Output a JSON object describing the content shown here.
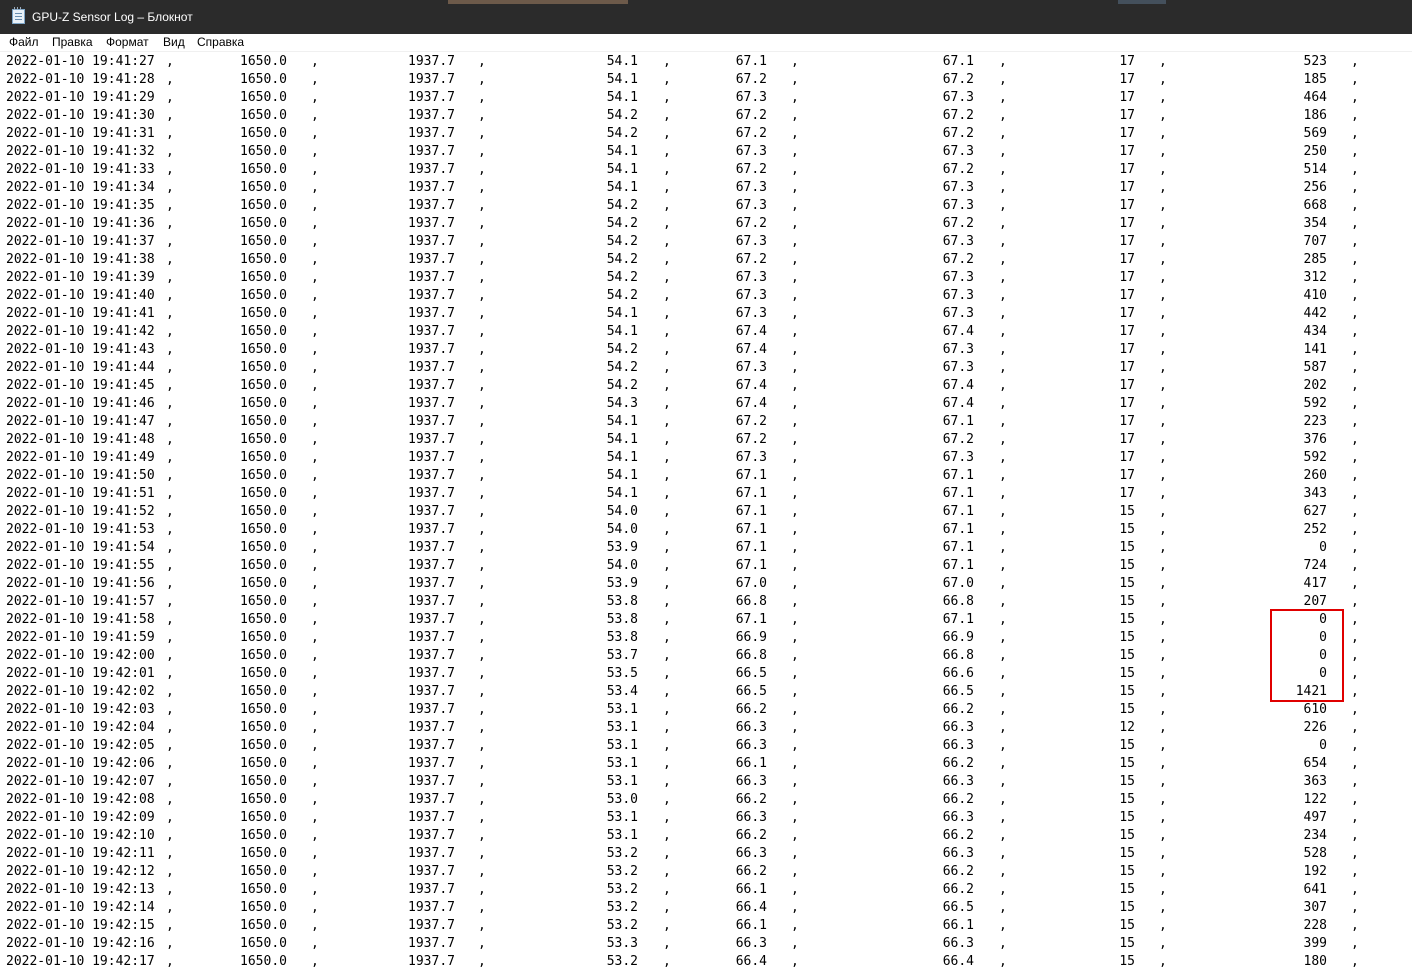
{
  "window": {
    "title": "GPU-Z Sensor Log – Блокнот",
    "app_icon": "notepad-icon"
  },
  "menu": [
    "Файл",
    "Правка",
    "Формат",
    "Вид",
    "Справка"
  ],
  "log": {
    "separator": ",",
    "rows": [
      [
        "2022-01-10 19:41:27",
        "1650.0",
        "1937.7",
        "54.1",
        "67.1",
        "67.1",
        "17",
        "523"
      ],
      [
        "2022-01-10 19:41:28",
        "1650.0",
        "1937.7",
        "54.1",
        "67.2",
        "67.2",
        "17",
        "185"
      ],
      [
        "2022-01-10 19:41:29",
        "1650.0",
        "1937.7",
        "54.1",
        "67.3",
        "67.3",
        "17",
        "464"
      ],
      [
        "2022-01-10 19:41:30",
        "1650.0",
        "1937.7",
        "54.2",
        "67.2",
        "67.2",
        "17",
        "186"
      ],
      [
        "2022-01-10 19:41:31",
        "1650.0",
        "1937.7",
        "54.2",
        "67.2",
        "67.2",
        "17",
        "569"
      ],
      [
        "2022-01-10 19:41:32",
        "1650.0",
        "1937.7",
        "54.1",
        "67.3",
        "67.3",
        "17",
        "250"
      ],
      [
        "2022-01-10 19:41:33",
        "1650.0",
        "1937.7",
        "54.1",
        "67.2",
        "67.2",
        "17",
        "514"
      ],
      [
        "2022-01-10 19:41:34",
        "1650.0",
        "1937.7",
        "54.1",
        "67.3",
        "67.3",
        "17",
        "256"
      ],
      [
        "2022-01-10 19:41:35",
        "1650.0",
        "1937.7",
        "54.2",
        "67.3",
        "67.3",
        "17",
        "668"
      ],
      [
        "2022-01-10 19:41:36",
        "1650.0",
        "1937.7",
        "54.2",
        "67.2",
        "67.2",
        "17",
        "354"
      ],
      [
        "2022-01-10 19:41:37",
        "1650.0",
        "1937.7",
        "54.2",
        "67.3",
        "67.3",
        "17",
        "707"
      ],
      [
        "2022-01-10 19:41:38",
        "1650.0",
        "1937.7",
        "54.2",
        "67.2",
        "67.2",
        "17",
        "285"
      ],
      [
        "2022-01-10 19:41:39",
        "1650.0",
        "1937.7",
        "54.2",
        "67.3",
        "67.3",
        "17",
        "312"
      ],
      [
        "2022-01-10 19:41:40",
        "1650.0",
        "1937.7",
        "54.2",
        "67.3",
        "67.3",
        "17",
        "410"
      ],
      [
        "2022-01-10 19:41:41",
        "1650.0",
        "1937.7",
        "54.1",
        "67.3",
        "67.3",
        "17",
        "442"
      ],
      [
        "2022-01-10 19:41:42",
        "1650.0",
        "1937.7",
        "54.1",
        "67.4",
        "67.4",
        "17",
        "434"
      ],
      [
        "2022-01-10 19:41:43",
        "1650.0",
        "1937.7",
        "54.2",
        "67.4",
        "67.3",
        "17",
        "141"
      ],
      [
        "2022-01-10 19:41:44",
        "1650.0",
        "1937.7",
        "54.2",
        "67.3",
        "67.3",
        "17",
        "587"
      ],
      [
        "2022-01-10 19:41:45",
        "1650.0",
        "1937.7",
        "54.2",
        "67.4",
        "67.4",
        "17",
        "202"
      ],
      [
        "2022-01-10 19:41:46",
        "1650.0",
        "1937.7",
        "54.3",
        "67.4",
        "67.4",
        "17",
        "592"
      ],
      [
        "2022-01-10 19:41:47",
        "1650.0",
        "1937.7",
        "54.1",
        "67.2",
        "67.1",
        "17",
        "223"
      ],
      [
        "2022-01-10 19:41:48",
        "1650.0",
        "1937.7",
        "54.1",
        "67.2",
        "67.2",
        "17",
        "376"
      ],
      [
        "2022-01-10 19:41:49",
        "1650.0",
        "1937.7",
        "54.1",
        "67.3",
        "67.3",
        "17",
        "592"
      ],
      [
        "2022-01-10 19:41:50",
        "1650.0",
        "1937.7",
        "54.1",
        "67.1",
        "67.1",
        "17",
        "260"
      ],
      [
        "2022-01-10 19:41:51",
        "1650.0",
        "1937.7",
        "54.1",
        "67.1",
        "67.1",
        "17",
        "343"
      ],
      [
        "2022-01-10 19:41:52",
        "1650.0",
        "1937.7",
        "54.0",
        "67.1",
        "67.1",
        "15",
        "627"
      ],
      [
        "2022-01-10 19:41:53",
        "1650.0",
        "1937.7",
        "54.0",
        "67.1",
        "67.1",
        "15",
        "252"
      ],
      [
        "2022-01-10 19:41:54",
        "1650.0",
        "1937.7",
        "53.9",
        "67.1",
        "67.1",
        "15",
        "0"
      ],
      [
        "2022-01-10 19:41:55",
        "1650.0",
        "1937.7",
        "54.0",
        "67.1",
        "67.1",
        "15",
        "724"
      ],
      [
        "2022-01-10 19:41:56",
        "1650.0",
        "1937.7",
        "53.9",
        "67.0",
        "67.0",
        "15",
        "417"
      ],
      [
        "2022-01-10 19:41:57",
        "1650.0",
        "1937.7",
        "53.8",
        "66.8",
        "66.8",
        "15",
        "207"
      ],
      [
        "2022-01-10 19:41:58",
        "1650.0",
        "1937.7",
        "53.8",
        "67.1",
        "67.1",
        "15",
        "0"
      ],
      [
        "2022-01-10 19:41:59",
        "1650.0",
        "1937.7",
        "53.8",
        "66.9",
        "66.9",
        "15",
        "0"
      ],
      [
        "2022-01-10 19:42:00",
        "1650.0",
        "1937.7",
        "53.7",
        "66.8",
        "66.8",
        "15",
        "0"
      ],
      [
        "2022-01-10 19:42:01",
        "1650.0",
        "1937.7",
        "53.5",
        "66.5",
        "66.6",
        "15",
        "0"
      ],
      [
        "2022-01-10 19:42:02",
        "1650.0",
        "1937.7",
        "53.4",
        "66.5",
        "66.5",
        "15",
        "1421"
      ],
      [
        "2022-01-10 19:42:03",
        "1650.0",
        "1937.7",
        "53.1",
        "66.2",
        "66.2",
        "15",
        "610"
      ],
      [
        "2022-01-10 19:42:04",
        "1650.0",
        "1937.7",
        "53.1",
        "66.3",
        "66.3",
        "12",
        "226"
      ],
      [
        "2022-01-10 19:42:05",
        "1650.0",
        "1937.7",
        "53.1",
        "66.3",
        "66.3",
        "15",
        "0"
      ],
      [
        "2022-01-10 19:42:06",
        "1650.0",
        "1937.7",
        "53.1",
        "66.1",
        "66.2",
        "15",
        "654"
      ],
      [
        "2022-01-10 19:42:07",
        "1650.0",
        "1937.7",
        "53.1",
        "66.3",
        "66.3",
        "15",
        "363"
      ],
      [
        "2022-01-10 19:42:08",
        "1650.0",
        "1937.7",
        "53.0",
        "66.2",
        "66.2",
        "15",
        "122"
      ],
      [
        "2022-01-10 19:42:09",
        "1650.0",
        "1937.7",
        "53.1",
        "66.3",
        "66.3",
        "15",
        "497"
      ],
      [
        "2022-01-10 19:42:10",
        "1650.0",
        "1937.7",
        "53.1",
        "66.2",
        "66.2",
        "15",
        "234"
      ],
      [
        "2022-01-10 19:42:11",
        "1650.0",
        "1937.7",
        "53.2",
        "66.3",
        "66.3",
        "15",
        "528"
      ],
      [
        "2022-01-10 19:42:12",
        "1650.0",
        "1937.7",
        "53.2",
        "66.2",
        "66.2",
        "15",
        "192"
      ],
      [
        "2022-01-10 19:42:13",
        "1650.0",
        "1937.7",
        "53.2",
        "66.1",
        "66.2",
        "15",
        "641"
      ],
      [
        "2022-01-10 19:42:14",
        "1650.0",
        "1937.7",
        "53.2",
        "66.4",
        "66.5",
        "15",
        "307"
      ],
      [
        "2022-01-10 19:42:15",
        "1650.0",
        "1937.7",
        "53.2",
        "66.1",
        "66.1",
        "15",
        "228"
      ],
      [
        "2022-01-10 19:42:16",
        "1650.0",
        "1937.7",
        "53.3",
        "66.3",
        "66.3",
        "15",
        "399"
      ],
      [
        "2022-01-10 19:42:17",
        "1650.0",
        "1937.7",
        "53.2",
        "66.4",
        "66.4",
        "15",
        "180"
      ]
    ]
  },
  "colors": {
    "titlebar_bg": "#2b2b2b",
    "highlight_border": "#e00000"
  }
}
